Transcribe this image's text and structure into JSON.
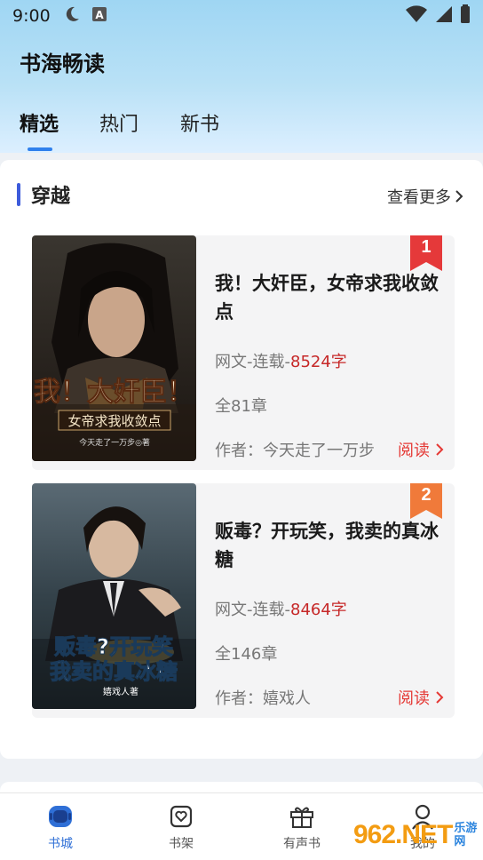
{
  "status": {
    "time": "9:00",
    "left_icons": [
      "moon-icon",
      "font-a-icon"
    ],
    "right_icons": [
      "wifi-icon",
      "signal-icon",
      "battery-icon"
    ]
  },
  "header": {
    "title": "书海畅读"
  },
  "tabs": [
    {
      "label": "精选",
      "active": true
    },
    {
      "label": "热门",
      "active": false
    },
    {
      "label": "新书",
      "active": false
    }
  ],
  "section": {
    "title": "穿越",
    "more_label": "查看更多"
  },
  "books": [
    {
      "rank": "1",
      "title": "我！大奸臣，女帝求我收敛点",
      "category": "网文-连载-",
      "words": "8524字",
      "chapters": "全81章",
      "author": "作者：今天走了一万步",
      "read_label": "阅读",
      "cover_title": "我！大奸臣！",
      "cover_subtitle": "女帝求我收敛点",
      "cover_author": "今天走了一万步◎著",
      "badge_color": "#e5393a"
    },
    {
      "rank": "2",
      "title": "贩毒？开玩笑，我卖的真冰糖",
      "category": "网文-连载-",
      "words": "8464字",
      "chapters": "全146章",
      "author": "作者：嬉戏人",
      "read_label": "阅读",
      "cover_title": "贩毒?开玩笑",
      "cover_subtitle": "我卖的真冰糖",
      "cover_author": "嬉戏人著",
      "badge_color": "#f07a3a"
    }
  ],
  "bottom_nav": [
    {
      "label": "书城",
      "icon": "bookstore-icon",
      "active": true
    },
    {
      "label": "书架",
      "icon": "bookshelf-heart-icon",
      "active": false
    },
    {
      "label": "有声书",
      "icon": "gift-icon",
      "active": false
    },
    {
      "label": "我的",
      "icon": "profile-icon",
      "active": false
    }
  ],
  "watermark": {
    "main": "962.NET",
    "side": "乐游网"
  }
}
